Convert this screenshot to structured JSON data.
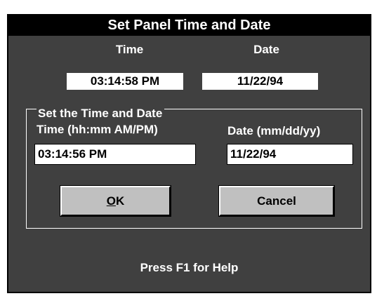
{
  "dialog": {
    "title": "Set Panel Time and Date",
    "help_text": "Press F1 for Help"
  },
  "current": {
    "time_label": "Time",
    "date_label": "Date",
    "time_value": "03:14:58 PM",
    "date_value": "11/22/94"
  },
  "set_group": {
    "title": "Set the Time and Date",
    "time_label": "Time (hh:mm AM/PM)",
    "date_label": "Date (mm/dd/yy)",
    "time_value": "03:14:56 PM",
    "date_value": "11/22/94"
  },
  "buttons": {
    "ok_mnemonic": "O",
    "ok_rest": "K",
    "cancel": "Cancel"
  },
  "colors": {
    "dialog_bg": "#404040",
    "title_bg": "#000000",
    "button_face": "#c0c0c0"
  }
}
